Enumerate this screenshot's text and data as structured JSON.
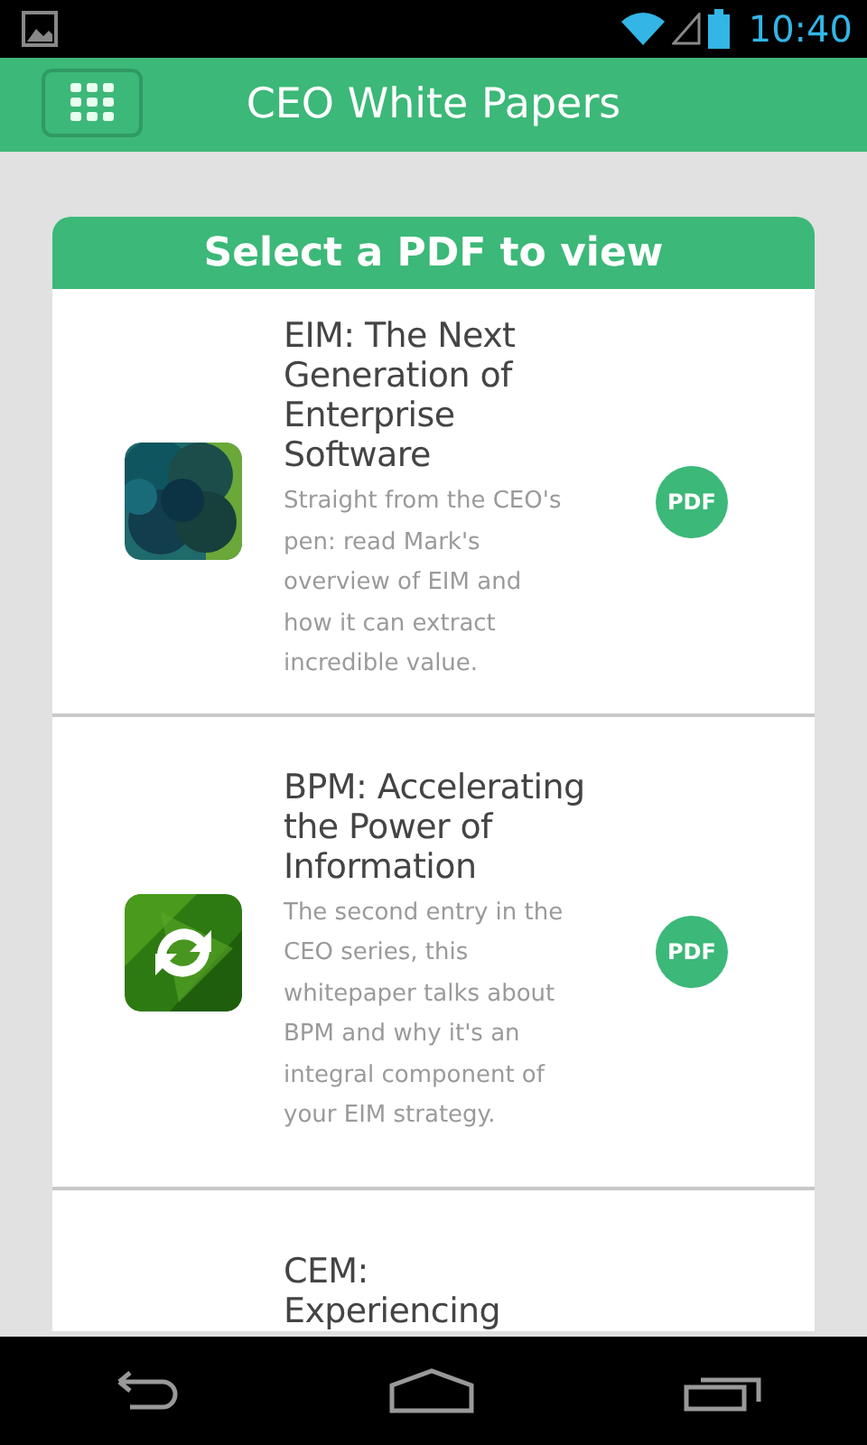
{
  "status_bar": {
    "time": "10:40"
  },
  "app_bar": {
    "title": "CEO White Papers"
  },
  "card": {
    "header": "Select a PDF to view",
    "items": [
      {
        "kind": "full",
        "title": "EIM: The Next Generation of Enterprise Software",
        "description": "Straight from the CEO's pen: read Mark's overview of EIM and how it can extract incredible value.",
        "button": "PDF"
      },
      {
        "kind": "full",
        "title": "BPM: Accelerating the Power of Information",
        "description": "The second entry in the CEO series, this whitepaper talks about BPM and why it's an integral component of your EIM strategy.",
        "button": "PDF"
      },
      {
        "kind": "partial",
        "title": "CEM: Experiencing"
      }
    ]
  }
}
